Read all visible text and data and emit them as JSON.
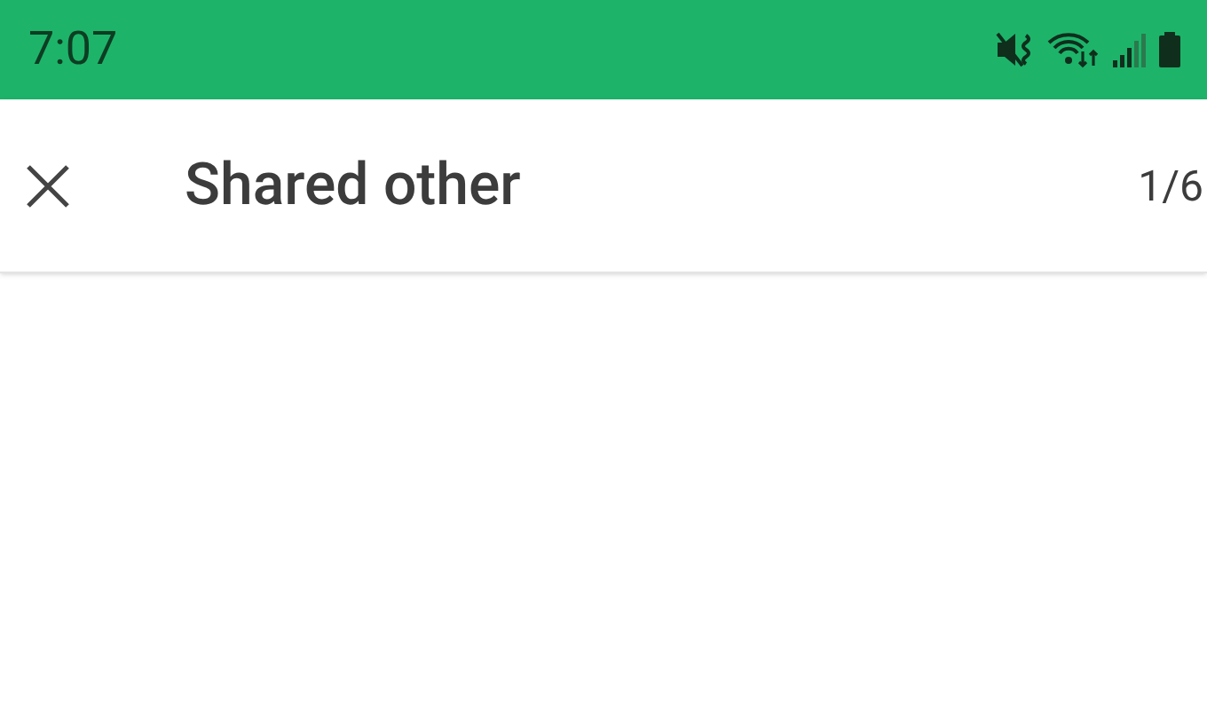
{
  "status_bar": {
    "time": "7:07"
  },
  "header": {
    "title": "Shared other",
    "counter": "1/6"
  }
}
